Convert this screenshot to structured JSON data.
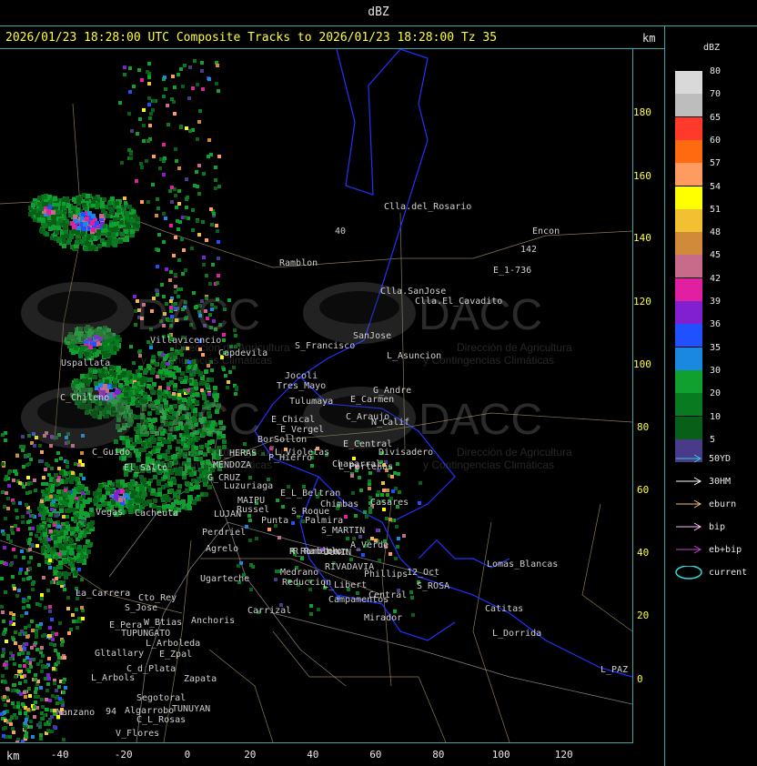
{
  "header": {
    "units_title": "dBZ"
  },
  "title_bar": {
    "text": "2026/01/23 18:28:00 UTC Composite Tracks to 2026/01/23 18:28:00 Tz 35",
    "km_label": "km"
  },
  "axes": {
    "x_label": "km",
    "x_ticks": [
      "-40",
      "-20",
      "0",
      "20",
      "40",
      "60",
      "80",
      "100",
      "120"
    ],
    "y_ticks": [
      "180",
      "160",
      "140",
      "120",
      "100",
      "80",
      "60",
      "40",
      "20",
      "0"
    ]
  },
  "legend": {
    "title": "dBZ",
    "scale": [
      {
        "value": "80",
        "color": "#d9d9d9"
      },
      {
        "value": "70",
        "color": "#bdbdbd"
      },
      {
        "value": "65",
        "color": "#ff3a2a"
      },
      {
        "value": "60",
        "color": "#ff6a10"
      },
      {
        "value": "57",
        "color": "#ff9a60"
      },
      {
        "value": "54",
        "color": "#ffff00"
      },
      {
        "value": "51",
        "color": "#f2c030"
      },
      {
        "value": "48",
        "color": "#d08a3a"
      },
      {
        "value": "45",
        "color": "#c86a8a"
      },
      {
        "value": "42",
        "color": "#e020a0"
      },
      {
        "value": "39",
        "color": "#8020d0"
      },
      {
        "value": "36",
        "color": "#2050ff"
      },
      {
        "value": "35",
        "color": "#1a88e0"
      },
      {
        "value": "30",
        "color": "#10a030"
      },
      {
        "value": "20",
        "color": "#087a20"
      },
      {
        "value": "10",
        "color": "#086018"
      },
      {
        "value": "5",
        "color": "#4a3a8a"
      }
    ],
    "tracks": [
      {
        "label": "50YD",
        "color": "#33cccc"
      },
      {
        "label": "30HM",
        "color": "#ffffff"
      },
      {
        "label": "eburn",
        "color": "#f0c080"
      },
      {
        "label": "bip",
        "color": "#ffc0ff"
      },
      {
        "label": "eb+bip",
        "color": "#d040d0"
      },
      {
        "label": "current",
        "color": "#33dddd"
      }
    ]
  },
  "watermark": {
    "brand": "DACC",
    "line1": "Dirección de Agricultura",
    "line2": "y Contingencias Climáticas"
  },
  "places": [
    "Clla.del_Rosario",
    "Encon",
    "142",
    "E_1-736",
    "Ramblon",
    "40",
    "Clla.SanJose",
    "Clla.El_Cavadito",
    "Villavicencio",
    "Capdevila",
    "S_Francisco",
    "SanJose",
    "L_Asuncion",
    "Uspallata",
    "Jocoli",
    "Tres_Mayo",
    "G_Andre",
    "C_Chileno",
    "Tulumaya",
    "E_Carmen",
    "E_Chical",
    "C_Araujo",
    "N_Calif",
    "E_Vergel",
    "BorSollon",
    "L_Violetas",
    "E_Central",
    "Divisadero",
    "C_Guido",
    "L_HERAS",
    "P_Hierro",
    "El_Salto",
    "MENDOZA",
    "L_Porteñas",
    "G_CRUZ",
    "Luzuriaga",
    "Chaparral",
    "MAIPU",
    "E_L_Beltran",
    "Russel",
    "Chimbas",
    "Casares",
    "LUJAN",
    "S_Roque",
    "Palmira",
    "Vegas",
    "Cacheuta",
    "Perdriel",
    "Punta",
    "S_MARTIN",
    "A_Verde",
    "Agrelo",
    "R_Ramblon",
    "R_Ramablon",
    "JUNIN",
    "Lomas_Blancas",
    "Medrano",
    "RIVADAVIA",
    "Phillips",
    "12_Oct",
    "Ugarteche",
    "Reduccion",
    "L_Libert",
    "S_ROSA",
    "La_Carrera",
    "Cto_Rey",
    "Campamentos",
    "Central",
    "Carrizal",
    "S_Jose",
    "Catitas",
    "W_Btias",
    "Anchoris",
    "E_Pera",
    "TUPUNGATO",
    "Mirador",
    "L_Dorrida",
    "L_Arboleda",
    "Gltallary",
    "E_Zpal",
    "C_d_Plata",
    "L_Arbols",
    "Zapata",
    "L_PAZ",
    "Segotoral",
    "Manzano",
    "TUNUYAN",
    "Algarrobo",
    "C_L_Rosas",
    "V_Flores",
    "94"
  ]
}
